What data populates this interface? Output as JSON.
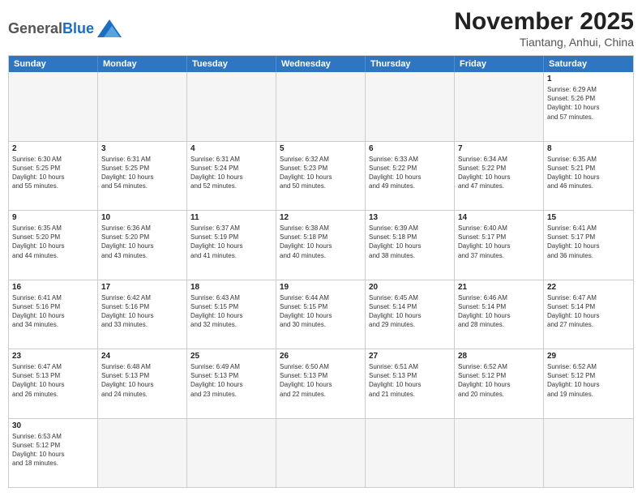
{
  "header": {
    "logo_general": "General",
    "logo_blue": "Blue",
    "month_title": "November 2025",
    "location": "Tiantang, Anhui, China"
  },
  "day_headers": [
    "Sunday",
    "Monday",
    "Tuesday",
    "Wednesday",
    "Thursday",
    "Friday",
    "Saturday"
  ],
  "weeks": [
    [
      {
        "day": "",
        "info": ""
      },
      {
        "day": "",
        "info": ""
      },
      {
        "day": "",
        "info": ""
      },
      {
        "day": "",
        "info": ""
      },
      {
        "day": "",
        "info": ""
      },
      {
        "day": "",
        "info": ""
      },
      {
        "day": "1",
        "info": "Sunrise: 6:29 AM\nSunset: 5:26 PM\nDaylight: 10 hours\nand 57 minutes."
      }
    ],
    [
      {
        "day": "2",
        "info": "Sunrise: 6:30 AM\nSunset: 5:25 PM\nDaylight: 10 hours\nand 55 minutes."
      },
      {
        "day": "3",
        "info": "Sunrise: 6:31 AM\nSunset: 5:25 PM\nDaylight: 10 hours\nand 54 minutes."
      },
      {
        "day": "4",
        "info": "Sunrise: 6:31 AM\nSunset: 5:24 PM\nDaylight: 10 hours\nand 52 minutes."
      },
      {
        "day": "5",
        "info": "Sunrise: 6:32 AM\nSunset: 5:23 PM\nDaylight: 10 hours\nand 50 minutes."
      },
      {
        "day": "6",
        "info": "Sunrise: 6:33 AM\nSunset: 5:22 PM\nDaylight: 10 hours\nand 49 minutes."
      },
      {
        "day": "7",
        "info": "Sunrise: 6:34 AM\nSunset: 5:22 PM\nDaylight: 10 hours\nand 47 minutes."
      },
      {
        "day": "8",
        "info": "Sunrise: 6:35 AM\nSunset: 5:21 PM\nDaylight: 10 hours\nand 46 minutes."
      }
    ],
    [
      {
        "day": "9",
        "info": "Sunrise: 6:35 AM\nSunset: 5:20 PM\nDaylight: 10 hours\nand 44 minutes."
      },
      {
        "day": "10",
        "info": "Sunrise: 6:36 AM\nSunset: 5:20 PM\nDaylight: 10 hours\nand 43 minutes."
      },
      {
        "day": "11",
        "info": "Sunrise: 6:37 AM\nSunset: 5:19 PM\nDaylight: 10 hours\nand 41 minutes."
      },
      {
        "day": "12",
        "info": "Sunrise: 6:38 AM\nSunset: 5:18 PM\nDaylight: 10 hours\nand 40 minutes."
      },
      {
        "day": "13",
        "info": "Sunrise: 6:39 AM\nSunset: 5:18 PM\nDaylight: 10 hours\nand 38 minutes."
      },
      {
        "day": "14",
        "info": "Sunrise: 6:40 AM\nSunset: 5:17 PM\nDaylight: 10 hours\nand 37 minutes."
      },
      {
        "day": "15",
        "info": "Sunrise: 6:41 AM\nSunset: 5:17 PM\nDaylight: 10 hours\nand 36 minutes."
      }
    ],
    [
      {
        "day": "16",
        "info": "Sunrise: 6:41 AM\nSunset: 5:16 PM\nDaylight: 10 hours\nand 34 minutes."
      },
      {
        "day": "17",
        "info": "Sunrise: 6:42 AM\nSunset: 5:16 PM\nDaylight: 10 hours\nand 33 minutes."
      },
      {
        "day": "18",
        "info": "Sunrise: 6:43 AM\nSunset: 5:15 PM\nDaylight: 10 hours\nand 32 minutes."
      },
      {
        "day": "19",
        "info": "Sunrise: 6:44 AM\nSunset: 5:15 PM\nDaylight: 10 hours\nand 30 minutes."
      },
      {
        "day": "20",
        "info": "Sunrise: 6:45 AM\nSunset: 5:14 PM\nDaylight: 10 hours\nand 29 minutes."
      },
      {
        "day": "21",
        "info": "Sunrise: 6:46 AM\nSunset: 5:14 PM\nDaylight: 10 hours\nand 28 minutes."
      },
      {
        "day": "22",
        "info": "Sunrise: 6:47 AM\nSunset: 5:14 PM\nDaylight: 10 hours\nand 27 minutes."
      }
    ],
    [
      {
        "day": "23",
        "info": "Sunrise: 6:47 AM\nSunset: 5:13 PM\nDaylight: 10 hours\nand 26 minutes."
      },
      {
        "day": "24",
        "info": "Sunrise: 6:48 AM\nSunset: 5:13 PM\nDaylight: 10 hours\nand 24 minutes."
      },
      {
        "day": "25",
        "info": "Sunrise: 6:49 AM\nSunset: 5:13 PM\nDaylight: 10 hours\nand 23 minutes."
      },
      {
        "day": "26",
        "info": "Sunrise: 6:50 AM\nSunset: 5:13 PM\nDaylight: 10 hours\nand 22 minutes."
      },
      {
        "day": "27",
        "info": "Sunrise: 6:51 AM\nSunset: 5:13 PM\nDaylight: 10 hours\nand 21 minutes."
      },
      {
        "day": "28",
        "info": "Sunrise: 6:52 AM\nSunset: 5:12 PM\nDaylight: 10 hours\nand 20 minutes."
      },
      {
        "day": "29",
        "info": "Sunrise: 6:52 AM\nSunset: 5:12 PM\nDaylight: 10 hours\nand 19 minutes."
      }
    ],
    [
      {
        "day": "30",
        "info": "Sunrise: 6:53 AM\nSunset: 5:12 PM\nDaylight: 10 hours\nand 18 minutes."
      },
      {
        "day": "",
        "info": ""
      },
      {
        "day": "",
        "info": ""
      },
      {
        "day": "",
        "info": ""
      },
      {
        "day": "",
        "info": ""
      },
      {
        "day": "",
        "info": ""
      },
      {
        "day": "",
        "info": ""
      }
    ]
  ]
}
